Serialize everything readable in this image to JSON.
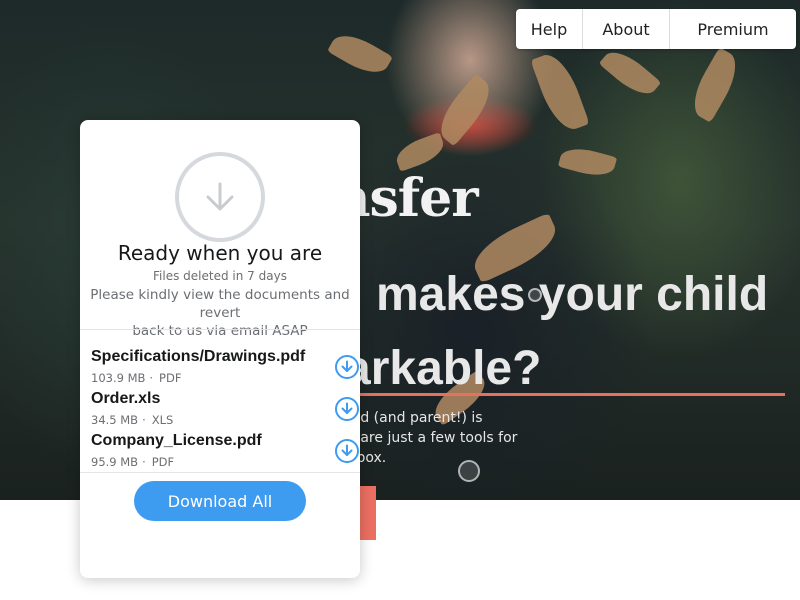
{
  "nav": {
    "help": "Help",
    "about": "About",
    "premium": "Premium"
  },
  "hero": {
    "brand_fragment": "ansfer",
    "headline_line1": "makes your child",
    "headline_line2": "arkable?",
    "body_line1": "child (and parent!) is",
    "body_line2": "se are just a few tools for",
    "body_line3": "olbox."
  },
  "transfer": {
    "title": "Ready when you are",
    "expiry": "Files deleted in 7 days",
    "message_line1": "Please kindly view the documents and revert",
    "message_line2": "back to us via email ASAP",
    "files": [
      {
        "name": "Specifications/Drawings.pdf",
        "size": "103.9 MB",
        "type": "PDF"
      },
      {
        "name": "Order.xls",
        "size": "34.5 MB",
        "type": "XLS"
      },
      {
        "name": "Company_License.pdf",
        "size": "95.9 MB",
        "type": "PDF"
      }
    ],
    "download_all": "Download All",
    "separator": "·"
  },
  "colors": {
    "accent": "#3d9bf0",
    "cta": "#ec6f63",
    "circle_border": "#d5d8dc"
  },
  "icons": [
    "download-arrow-icon",
    "download-circle-icon"
  ]
}
